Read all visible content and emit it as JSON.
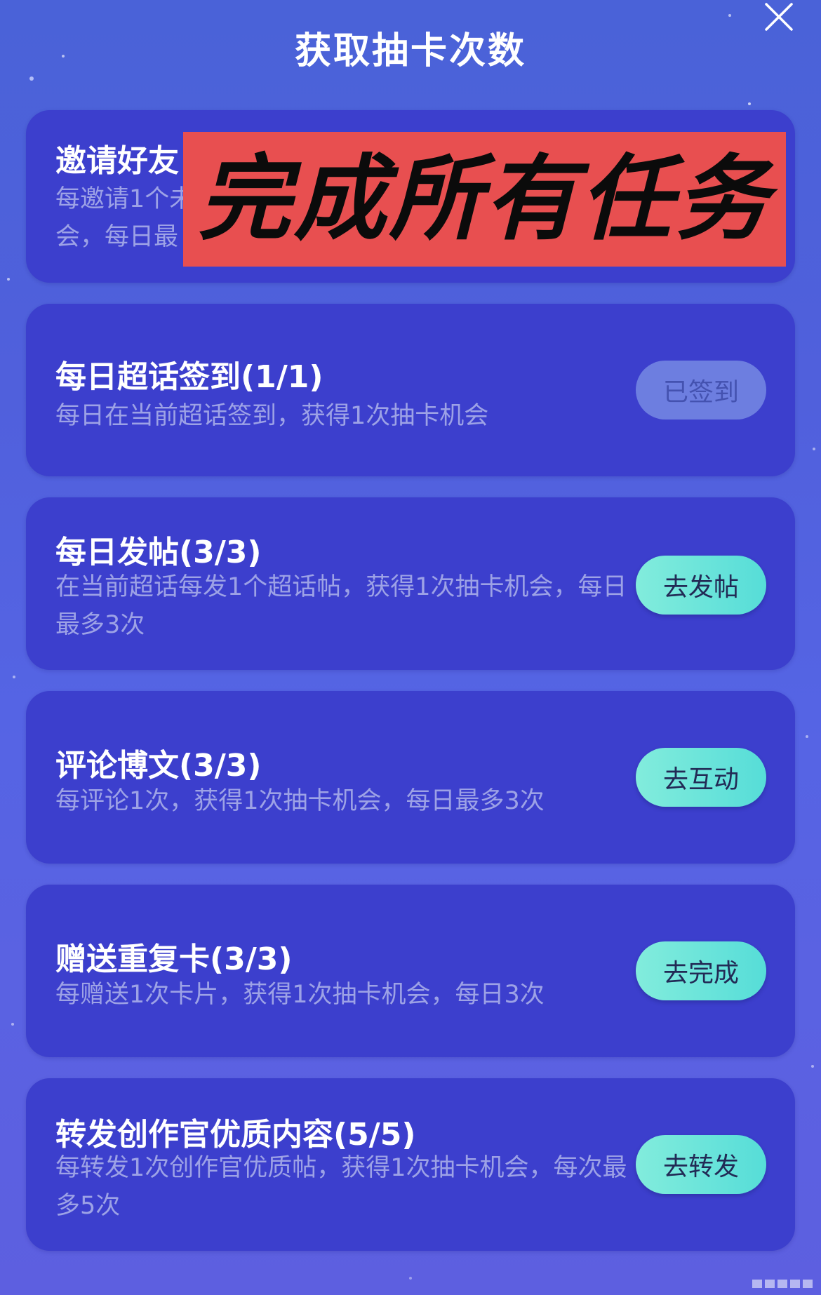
{
  "header": {
    "title": "获取抽卡次数",
    "close_icon": "close-icon"
  },
  "overlay": {
    "text": "完成所有任务",
    "background": "#e84f50"
  },
  "tasks": [
    {
      "title": "邀请好友",
      "desc": "每邀请1个未\n会，每日最",
      "button": ""
    },
    {
      "title": "每日超话签到(1/1)",
      "desc": "每日在当前超话签到，获得1次抽卡机会",
      "button": "已签到",
      "done": true
    },
    {
      "title": "每日发帖(3/3)",
      "desc": "在当前超话每发1个超话帖，获得1次抽卡机会，每日最多3次",
      "button": "去发帖"
    },
    {
      "title": "评论博文(3/3)",
      "desc": "每评论1次，获得1次抽卡机会，每日最多3次",
      "button": "去互动"
    },
    {
      "title": "赠送重复卡(3/3)",
      "desc": "每赠送1次卡片，获得1次抽卡机会，每日3次",
      "button": "去完成"
    },
    {
      "title": "转发创作官优质内容(5/5)",
      "desc": "每转发1次创作官优质帖，获得1次抽卡机会，每次最多5次",
      "button": "去转发"
    }
  ],
  "colors": {
    "card_bg": "#3c3fcd",
    "button_accent": "#56ddd8",
    "button_done": "#6d7ee0",
    "desc_text": "#9da2e6"
  }
}
